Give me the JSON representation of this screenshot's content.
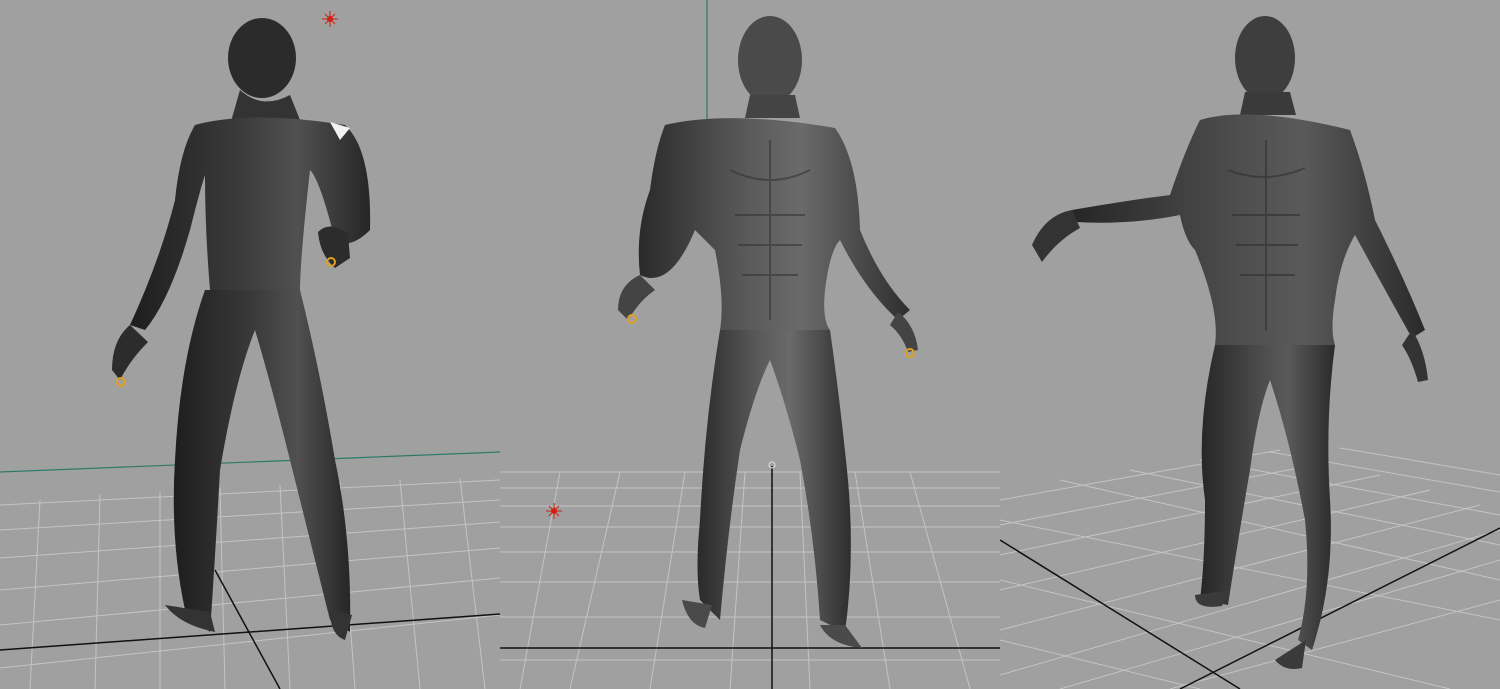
{
  "viewports": [
    {
      "view": "back-three-quarter",
      "label": ""
    },
    {
      "view": "front",
      "label": ""
    },
    {
      "view": "front-perspective",
      "label": ""
    }
  ],
  "colors": {
    "background": "#a0a0a0",
    "grid": "#c4c4c4",
    "axis": "#111111",
    "horizon": "#2e7a6a",
    "body_dark": "#2a2a2a",
    "body_mid": "#4a4a4a",
    "body_light": "#8a8a8a",
    "light_marker": "#d02010",
    "joint_marker": "#e0a020"
  },
  "icons": [
    "light-icon",
    "joint-marker-icon",
    "pivot-marker-icon"
  ]
}
